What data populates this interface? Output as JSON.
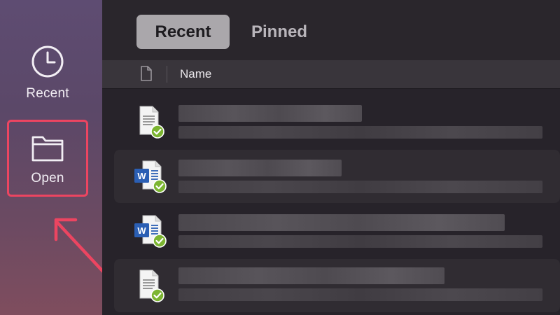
{
  "sidebar": {
    "items": [
      {
        "label": "Recent",
        "icon": "clock-icon"
      },
      {
        "label": "Open",
        "icon": "folder-icon",
        "highlighted": true
      }
    ]
  },
  "tabs": [
    {
      "label": "Recent",
      "selected": true
    },
    {
      "label": "Pinned",
      "selected": false
    }
  ],
  "file_list": {
    "column_header": "Name",
    "rows": [
      {
        "file_type": "generic-document",
        "sync_status": "synced",
        "content": "blurred"
      },
      {
        "file_type": "word-document",
        "sync_status": "synced",
        "content": "blurred"
      },
      {
        "file_type": "word-document",
        "sync_status": "synced",
        "content": "blurred"
      },
      {
        "file_type": "generic-document",
        "sync_status": "synced",
        "content": "blurred"
      }
    ]
  },
  "colors": {
    "highlight_box": "#ec4561",
    "arrow": "#ec4561",
    "selected_tab_bg": "#aaa7ab",
    "sync_badge": "#7cb531",
    "word_blue": "#2b5fb4"
  }
}
